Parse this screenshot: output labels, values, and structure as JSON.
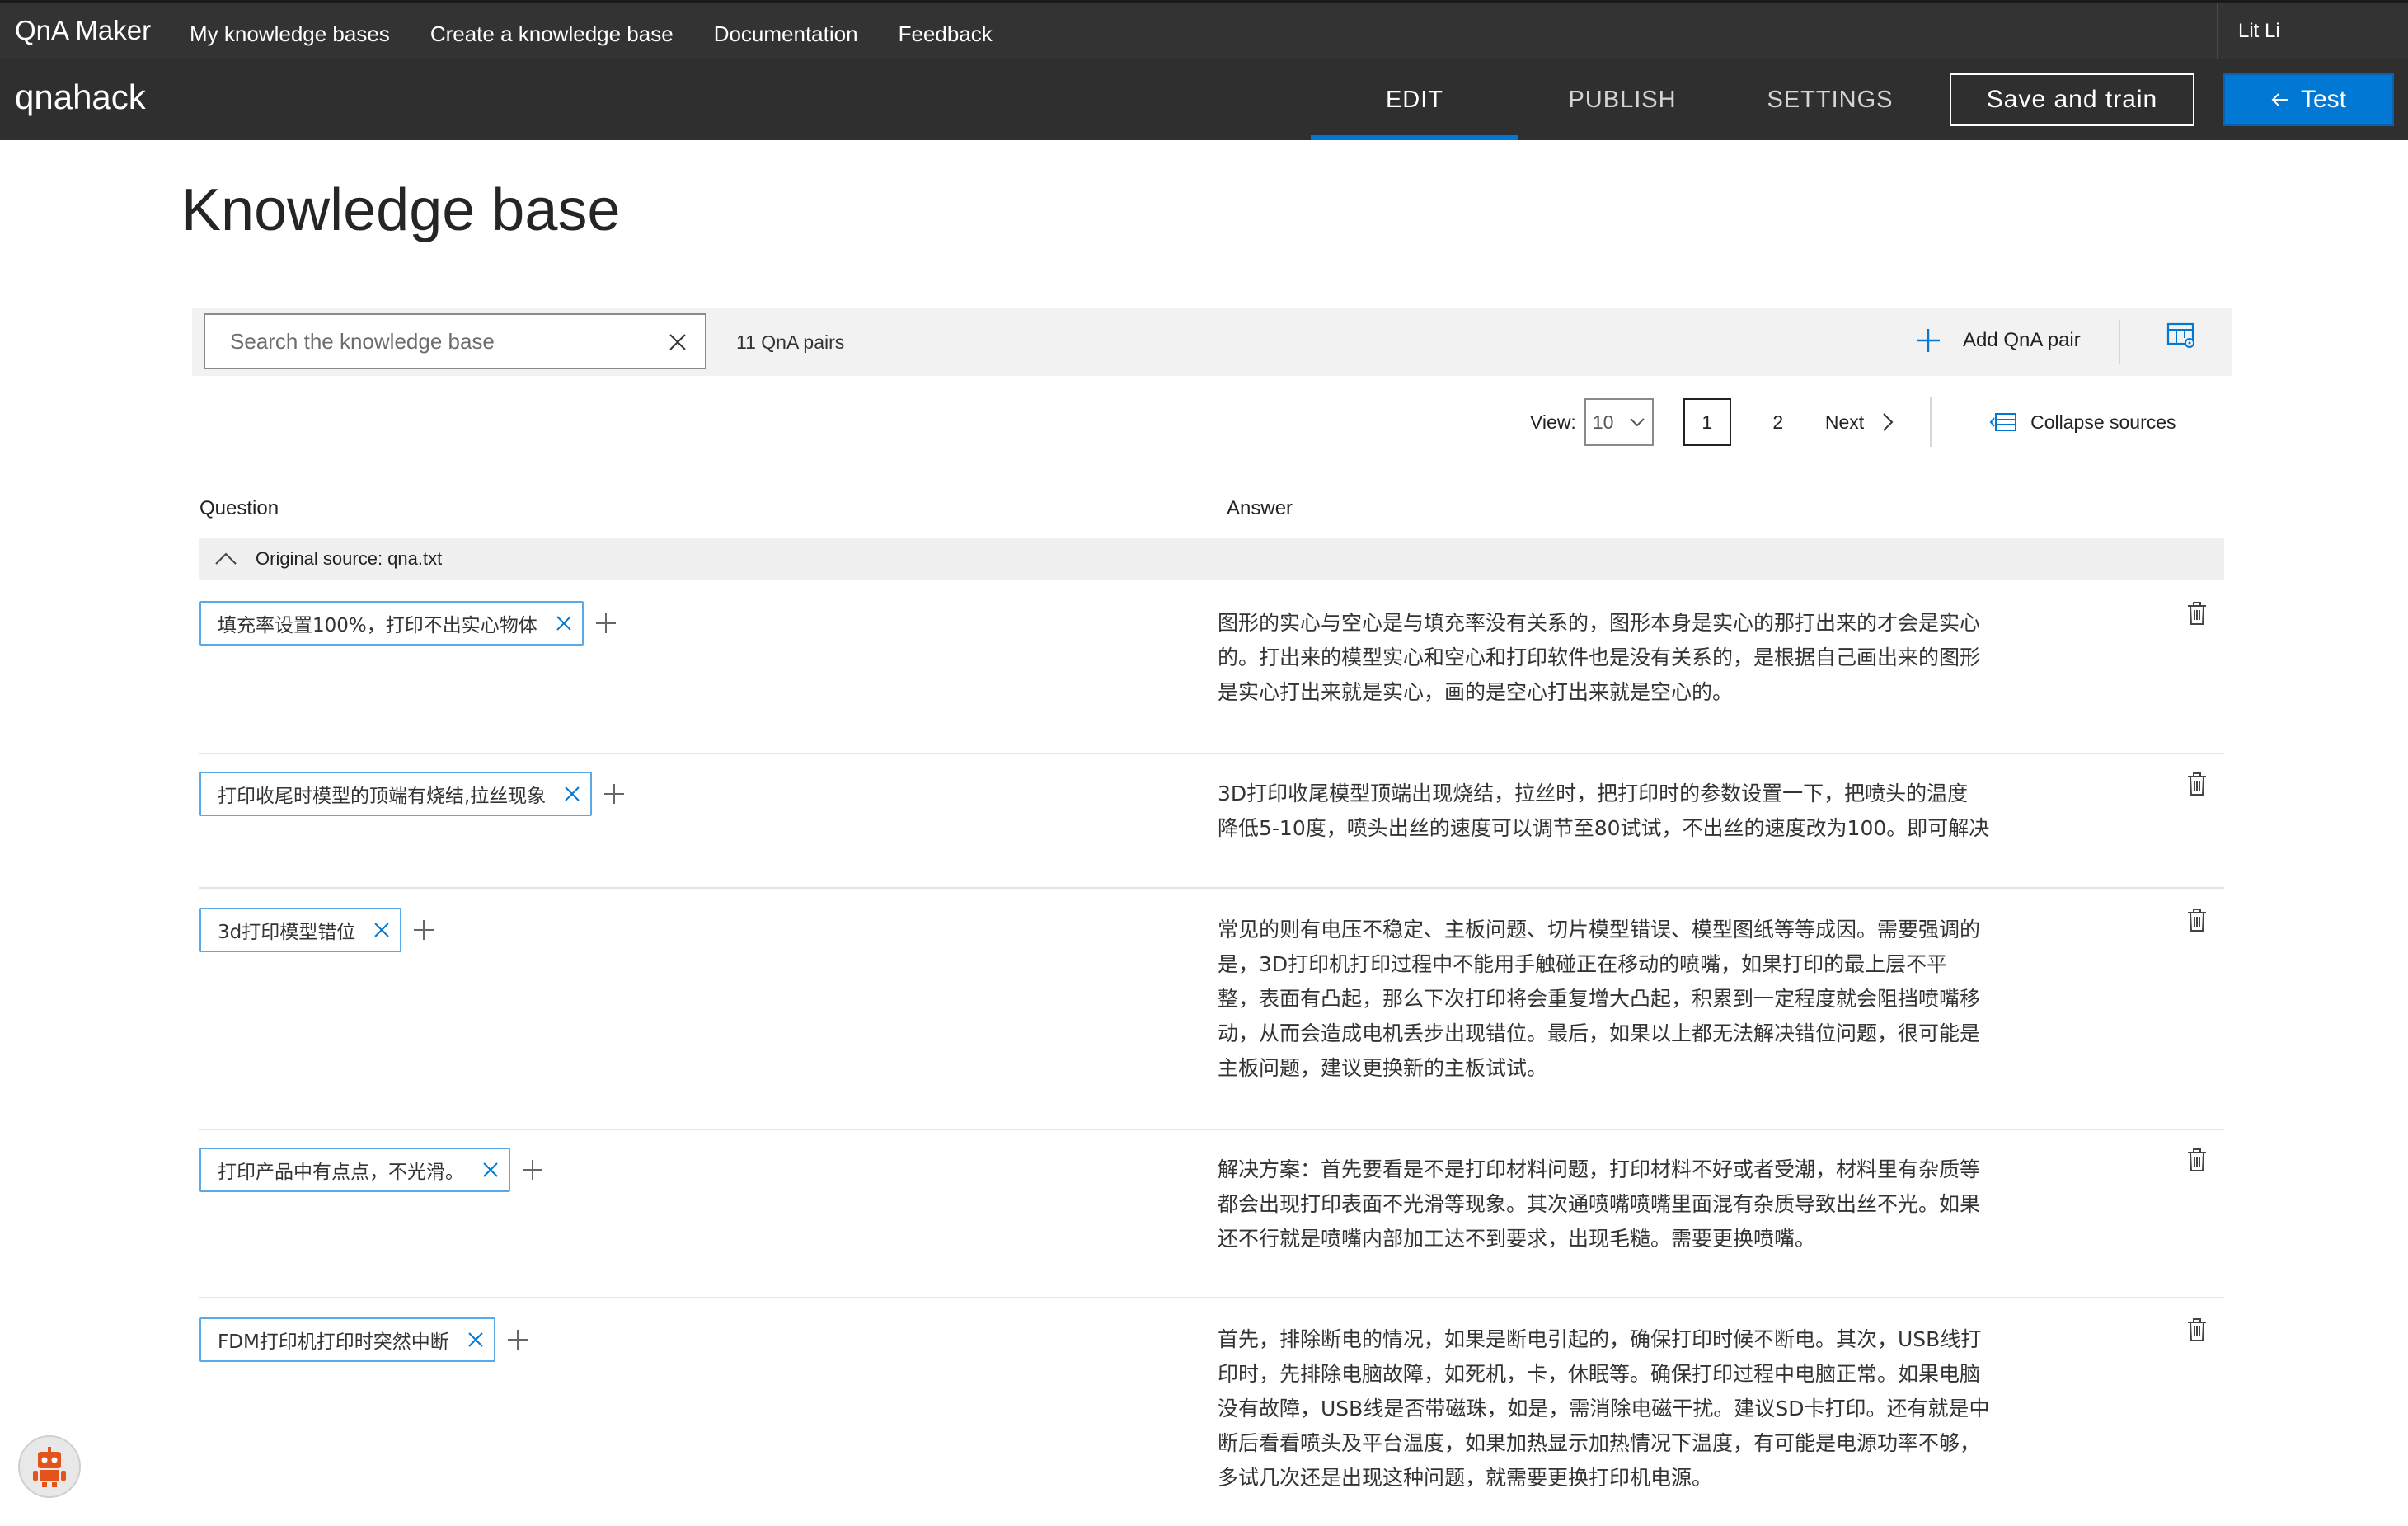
{
  "app": {
    "brand": "QnA Maker",
    "nav": [
      "My knowledge bases",
      "Create a knowledge base",
      "Documentation",
      "Feedback"
    ],
    "user": "Lit Li"
  },
  "kb": {
    "name": "qnahack",
    "tabs": [
      "EDIT",
      "PUBLISH",
      "SETTINGS"
    ],
    "active_tab": "EDIT",
    "save_label": "Save and train",
    "test_label": "Test",
    "accent": "#0078d4"
  },
  "page": {
    "title": "Knowledge base"
  },
  "toolbar": {
    "search_placeholder": "Search the knowledge base",
    "pair_count": "11 QnA pairs",
    "add_label": "Add QnA pair"
  },
  "pager": {
    "view_label": "View:",
    "view_value": "10",
    "pages": [
      "1",
      "2"
    ],
    "current_page": "1",
    "next_label": "Next",
    "collapse_label": "Collapse sources"
  },
  "table": {
    "question_header": "Question",
    "answer_header": "Answer",
    "source_label": "Original source: qna.txt",
    "rows": [
      {
        "question": "填充率设置100%，打印不出实心物体",
        "answer_lines": [
          "图形的实心与空心是与填充率没有关系的，图形本身是实心的那打出来的才会是实心",
          "的。打出来的模型实心和空心和打印软件也是没有关系的，是根据自己画出来的图形",
          "是实心打出来就是实心，画的是空心打出来就是空心的。"
        ]
      },
      {
        "question": "打印收尾时模型的顶端有烧结,拉丝现象",
        "answer_lines": [
          "3D打印收尾模型顶端出现烧结，拉丝时，把打印时的参数设置一下，把喷头的温度",
          "降低5-10度，喷头出丝的速度可以调节至80试试，不出丝的速度改为100。即可解决"
        ]
      },
      {
        "question": "3d打印模型错位",
        "answer_lines": [
          "常见的则有电压不稳定、主板问题、切片模型错误、模型图纸等等成因。需要强调的",
          "是，3D打印机打印过程中不能用手触碰正在移动的喷嘴，如果打印的最上层不平",
          "整，表面有凸起，那么下次打印将会重复增大凸起，积累到一定程度就会阻挡喷嘴移",
          "动，从而会造成电机丢步出现错位。最后，如果以上都无法解决错位问题，很可能是",
          "主板问题，建议更换新的主板试试。"
        ]
      },
      {
        "question": "打印产品中有点点，不光滑。",
        "answer_lines": [
          "解决方案：首先要看是不是打印材料问题，打印材料不好或者受潮，材料里有杂质等",
          "都会出现打印表面不光滑等现象。其次通喷嘴喷嘴里面混有杂质导致出丝不光。如果",
          "还不行就是喷嘴内部加工达不到要求，出现毛糙。需要更换喷嘴。"
        ]
      },
      {
        "question": "FDM打印机打印时突然中断",
        "answer_lines": [
          "首先，排除断电的情况，如果是断电引起的，确保打印时候不断电。其次，USB线打",
          "印时，先排除电脑故障，如死机，卡，休眠等。确保打印过程中电脑正常。如果电脑",
          "没有故障，USB线是否带磁珠，如是，需消除电磁干扰。建议SD卡打印。还有就是中",
          "断后看看喷头及平台温度，如果加热显示加热情况下温度，有可能是电源功率不够，",
          "多试几次还是出现这种问题，就需要更换打印机电源。"
        ]
      }
    ]
  }
}
